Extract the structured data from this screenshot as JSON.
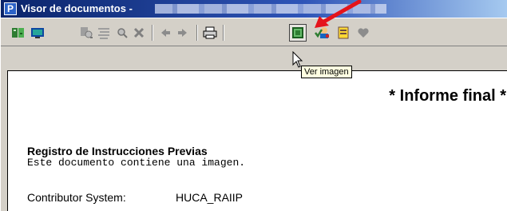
{
  "window": {
    "title": "Visor de documentos -",
    "app_icon_letter": "P"
  },
  "toolbar": {
    "buttons": [
      {
        "icon": "document-go-icon",
        "color": "#2e7d32"
      },
      {
        "icon": "monitor-icon",
        "color": "#1565c0"
      },
      {
        "icon": "print-preview-icon",
        "color": "#808080"
      },
      {
        "icon": "list-icon",
        "color": "#808080"
      },
      {
        "icon": "search-icon",
        "color": "#808080"
      },
      {
        "icon": "close-x-icon",
        "color": "#808080"
      },
      {
        "icon": "arrow-left-icon",
        "color": "#808080"
      },
      {
        "icon": "arrow-right-icon",
        "color": "#808080"
      },
      {
        "icon": "printer-icon",
        "color": "#000000"
      },
      {
        "icon": "view-image-icon",
        "color": "#1b5e20"
      },
      {
        "icon": "user-check-icon",
        "color": "#c62828"
      },
      {
        "icon": "document-yellow-icon",
        "color": "#f9a825"
      },
      {
        "icon": "heart-icon",
        "color": "#808080"
      }
    ],
    "tooltip": "Ver imagen"
  },
  "document": {
    "heading": "* Informe final *",
    "subtitle": "Registro de Instrucciones Previas",
    "notice": "Este documento contiene una imagen.",
    "field_label": "Contributor System:",
    "field_value": "HUCA_RAIIP"
  },
  "colors": {
    "annotation_arrow": "#e5141b",
    "titlebar_start": "#0a246a",
    "titlebar_end": "#a6caf0",
    "tooltip_bg": "#ffffe1"
  }
}
